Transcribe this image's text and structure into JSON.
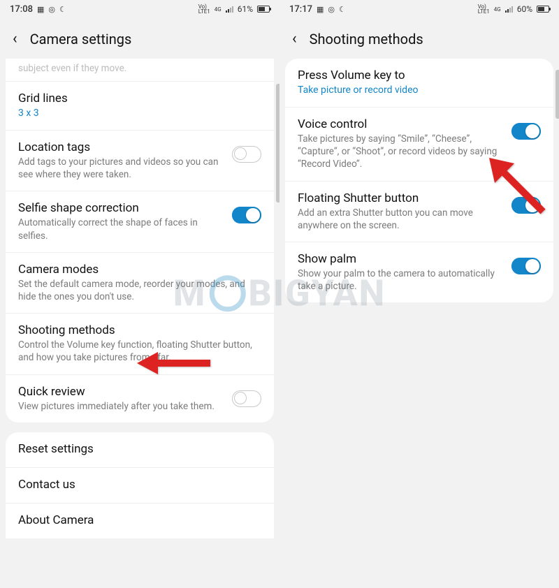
{
  "left": {
    "status": {
      "time": "17:08",
      "net": "Vo)\nLTE1",
      "sig": "4G",
      "battery_pct": "61%"
    },
    "header": {
      "title": "Camera settings"
    },
    "cut_text": "subject even if they move.",
    "items": [
      {
        "title": "Grid lines",
        "sub": "3 x 3",
        "sub_is_link": true,
        "toggle": null
      },
      {
        "title": "Location tags",
        "sub": "Add tags to your pictures and videos so you can see where they were taken.",
        "toggle": "off"
      },
      {
        "title": "Selfie shape correction",
        "sub": "Automatically correct the shape of faces in selfies.",
        "toggle": "on"
      },
      {
        "title": "Camera modes",
        "sub": "Set the default camera mode, reorder your modes, and hide the ones you don't use.",
        "toggle": null
      },
      {
        "title": "Shooting methods",
        "sub": "Control the Volume key function, floating Shutter button, and how you take pictures from afar.",
        "toggle": null
      },
      {
        "title": "Quick review",
        "sub": "View pictures immediately after you take them.",
        "toggle": "off"
      }
    ],
    "footer_items": [
      {
        "title": "Reset settings"
      },
      {
        "title": "Contact us"
      },
      {
        "title": "About Camera"
      }
    ]
  },
  "right": {
    "status": {
      "time": "17:17",
      "net": "Vo)\nLTE1",
      "sig": "4G",
      "battery_pct": "60%"
    },
    "header": {
      "title": "Shooting methods"
    },
    "items": [
      {
        "title": "Press Volume key to",
        "sub": "Take picture or record video",
        "sub_is_link": true,
        "toggle": null
      },
      {
        "title": "Voice control",
        "sub": "Take pictures by saying “Smile”, “Cheese”, “Capture”, or “Shoot”, or record videos by saying “Record Video”.",
        "toggle": "on"
      },
      {
        "title": "Floating Shutter button",
        "sub": "Add an extra Shutter button you can move anywhere on the screen.",
        "toggle": "on"
      },
      {
        "title": "Show palm",
        "sub": "Show your palm to the camera to automatically take a picture.",
        "toggle": "on"
      }
    ]
  },
  "watermark": {
    "pre": "M",
    "post": "BIGYAN"
  }
}
